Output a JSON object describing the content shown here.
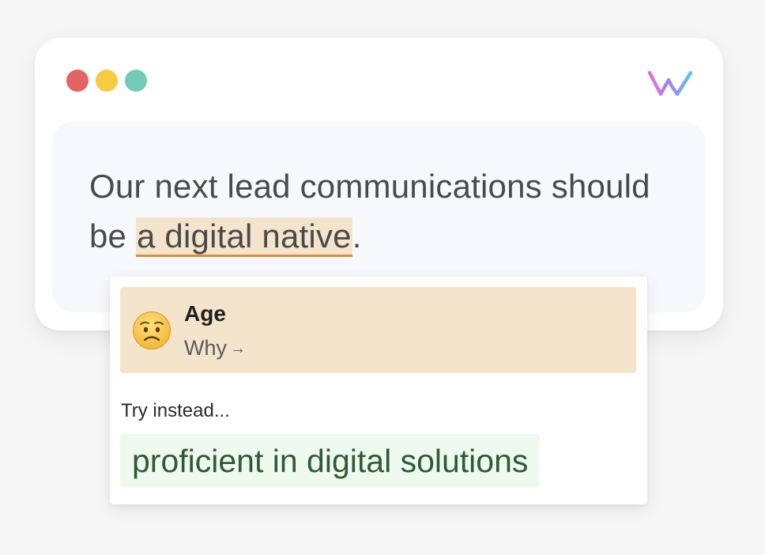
{
  "window": {
    "traffic_lights": [
      {
        "name": "close",
        "color": "#e26464"
      },
      {
        "name": "minimize",
        "color": "#f9cb40"
      },
      {
        "name": "zoom",
        "color": "#72cbb7"
      }
    ],
    "logo_icon": "w-logo-icon"
  },
  "editor": {
    "text_before": "Our next lead communications should be ",
    "flagged_phrase": "a digital native",
    "text_after": "."
  },
  "popup": {
    "issue": {
      "emoji_icon": "worried-face-icon",
      "title": "Age",
      "why_label": "Why",
      "why_arrow": "→"
    },
    "try_instead_label": "Try instead...",
    "suggestion": "proficient in digital solutions"
  },
  "colors": {
    "flag_highlight": "#f4e4cc",
    "flag_underline": "#e08a3c",
    "suggestion_bg": "#effaef",
    "suggestion_text": "#2f5a35"
  }
}
